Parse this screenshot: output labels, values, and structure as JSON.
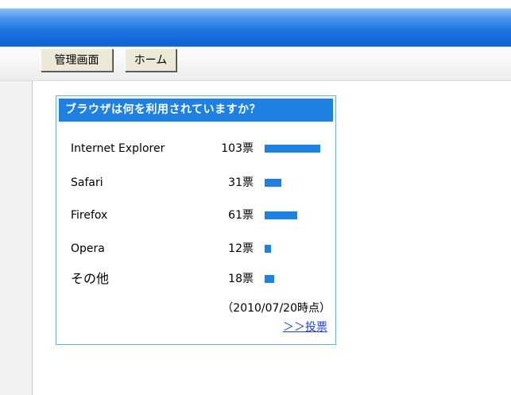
{
  "toolbar": {
    "admin_label": "管理画面",
    "home_label": "ホーム"
  },
  "poll": {
    "title": "ブラウザは何を利用されていますか？",
    "rows": [
      {
        "name": "Internet Explorer",
        "votes": 103,
        "count_label": "103票"
      },
      {
        "name": "Safari",
        "votes": 31,
        "count_label": "31票"
      },
      {
        "name": "Firefox",
        "votes": 61,
        "count_label": "61票"
      },
      {
        "name": "Opera",
        "votes": 12,
        "count_label": "12票"
      },
      {
        "name": "その他",
        "votes": 18,
        "count_label": "18票"
      }
    ],
    "as_of": "（2010/07/20時点）",
    "vote_link": "＞＞投票",
    "bar_color": "#1d80e2"
  }
}
